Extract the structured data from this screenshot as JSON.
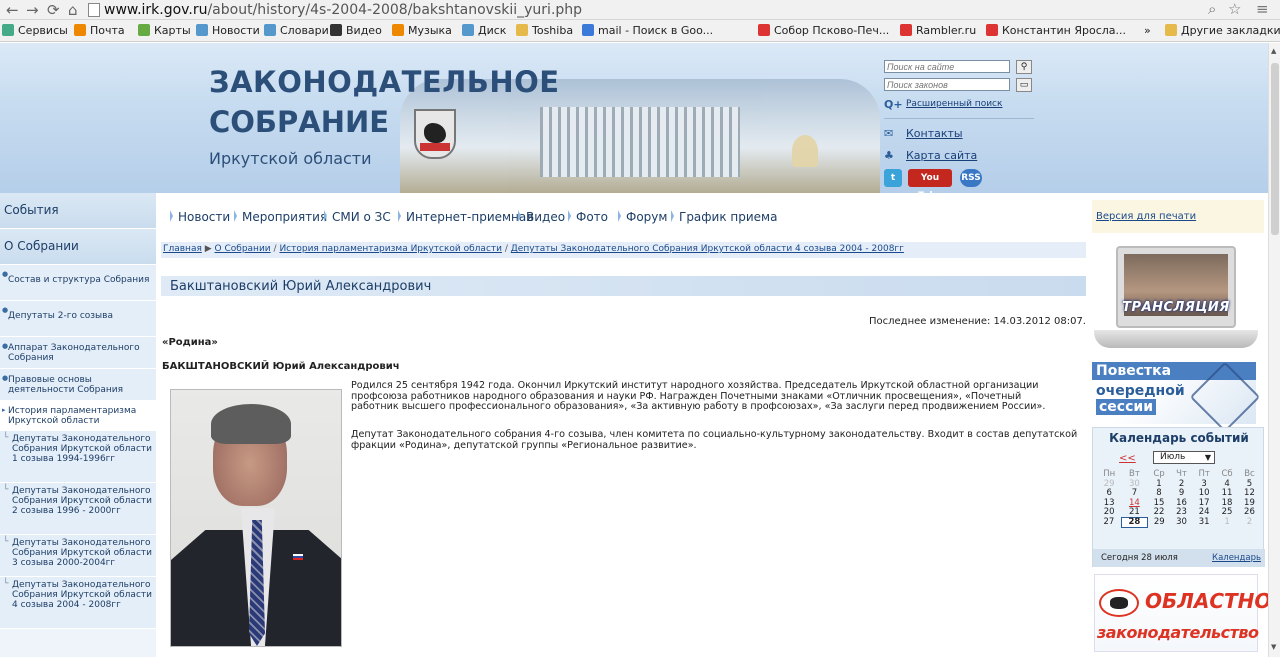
{
  "browser": {
    "url_host": "www.irk.gov.ru",
    "url_path": "/about/history/4s-2004-2008/bakshtanovskii_yuri.php",
    "bookmarks": [
      "Сервисы",
      "Почта",
      "Карты",
      "Новости",
      "Словари",
      "Видео",
      "Музыка",
      "Диск",
      "Toshiba",
      "mail - Поиск в Goo...",
      "Собор Псково-Печ...",
      "Rambler.ru",
      "Константин Яросла..."
    ],
    "other_bookmarks": "Другие закладки",
    "more": "»"
  },
  "header": {
    "title_line1": "ЗАКОНОДАТЕЛЬНОЕ",
    "title_line2": "СОБРАНИЕ",
    "title_line3": "Иркутской области",
    "search_site_placeholder": "Поиск на сайте",
    "search_law_placeholder": "Поиск законов",
    "advanced_search": "Расширенный поиск",
    "contacts": "Контакты",
    "sitemap": "Карта сайта",
    "youtube": "You Tube",
    "rss": "RSS"
  },
  "leftnav": {
    "sections": [
      "События",
      "О Собрании"
    ],
    "items": [
      "Состав и структура Собрания",
      "Депутаты 2-го созыва",
      "Аппарат Законодательного Собрания",
      "Правовые основы деятельности Собрания",
      "История парламентаризма Иркутской области"
    ],
    "subitems": [
      "Депутаты Законодательного Собрания Иркутской области 1 созыва 1994-1996гг",
      "Депутаты Законодательного Собрания Иркутской области 2 созыва 1996 - 2000гг",
      "Депутаты Законодательного Собрания Иркутской области 3 созыва 2000-2004гг",
      "Депутаты Законодательного Собрания Иркутской области 4 созыва 2004 - 2008гг"
    ]
  },
  "topnav": [
    "Новости",
    "Мероприятия",
    "СМИ о ЗС",
    "Интернет-приемная",
    "Видео",
    "Фото",
    "Форум",
    "График приема"
  ],
  "breadcrumb": [
    "Главная",
    "О Собрании",
    "История парламентаризма Иркутской области",
    "Депутаты Законодательного Собрания Иркутской области 4 созыва 2004 - 2008гг"
  ],
  "article": {
    "title": "Бакштановский Юрий Александрович",
    "modified": "Последнее изменение: 14.03.2012 08:07.",
    "party": "«Родина»",
    "fullname": "БАКШТАНОВСКИЙ Юрий Александрович",
    "bio1": "Родился 25 сентября 1942 года. Окончил Иркутский институт народного хозяйства. Председатель Иркутской областной организации профсоюза работников народного образования и науки РФ. Награжден Почетными знаками «Отличник просвещения», «Почетный работник высшего профессионального образования», «За активную работу в профсоюзах», «За заслуги перед продвижением России».",
    "bio2": "Депутат Законодательного собрания 4-го созыва, член комитета по социально-культурному законодательству. Входит в состав депутатской фракции «Родина», депутатской группы «Региональное развитие»."
  },
  "right": {
    "print": "Версия для печати",
    "broadcast": "ТРАНСЛЯЦИЯ",
    "agenda_l1": "Повестка",
    "agenda_l2": "очередной",
    "agenda_l3": "сессии",
    "calendar_title": "Календарь событий",
    "calendar_prev": "<<",
    "calendar_month": "Июль",
    "calendar_days": [
      "Пн",
      "Вт",
      "Ср",
      "Чт",
      "Пт",
      "Сб",
      "Вс"
    ],
    "calendar_weeks": [
      [
        "29",
        "30",
        "1",
        "2",
        "3",
        "4",
        "5"
      ],
      [
        "6",
        "7",
        "8",
        "9",
        "10",
        "11",
        "12"
      ],
      [
        "13",
        "14",
        "15",
        "16",
        "17",
        "18",
        "19"
      ],
      [
        "20",
        "21",
        "22",
        "23",
        "24",
        "25",
        "26"
      ],
      [
        "27",
        "28",
        "29",
        "30",
        "31",
        "1",
        "2"
      ]
    ],
    "today_text": "Сегодня 28 июля",
    "calendar_link": "Календарь",
    "banner_l1": "ОБЛАСТНОЕ",
    "banner_l2": "законодательство"
  }
}
